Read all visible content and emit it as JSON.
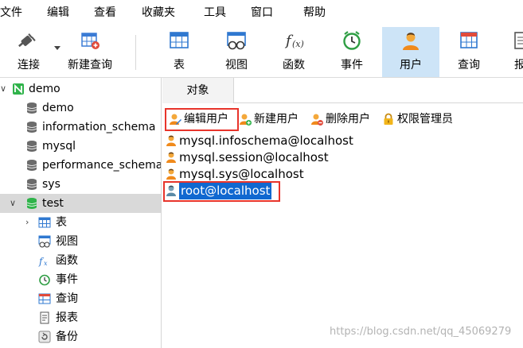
{
  "menu": [
    "文件",
    "编辑",
    "查看",
    "收藏夹",
    "工具",
    "窗口",
    "帮助"
  ],
  "toolbar": {
    "items": [
      {
        "label": "连接",
        "icon": "plug-icon"
      },
      {
        "label": "新建查询",
        "icon": "new-query-icon"
      },
      {
        "label": "表",
        "icon": "table-icon"
      },
      {
        "label": "视图",
        "icon": "view-icon"
      },
      {
        "label": "函数",
        "icon": "function-icon"
      },
      {
        "label": "事件",
        "icon": "clock-icon"
      },
      {
        "label": "用户",
        "icon": "user-icon"
      },
      {
        "label": "查询",
        "icon": "query-icon"
      },
      {
        "label": "报",
        "icon": "report-icon"
      }
    ],
    "active": "用户"
  },
  "tree": {
    "connection": "demo",
    "databases": [
      "demo",
      "information_schema",
      "mysql",
      "performance_schema",
      "sys",
      "test"
    ],
    "open_database": "test",
    "children": [
      {
        "label": "表",
        "icon": "table-icon"
      },
      {
        "label": "视图",
        "icon": "view-icon"
      },
      {
        "label": "函数",
        "icon": "function-icon"
      },
      {
        "label": "事件",
        "icon": "clock-icon"
      },
      {
        "label": "查询",
        "icon": "query-icon"
      },
      {
        "label": "报表",
        "icon": "report-icon"
      },
      {
        "label": "备份",
        "icon": "backup-icon"
      }
    ]
  },
  "tab": {
    "label": "对象"
  },
  "object_toolbar": {
    "edit_user": "编辑用户",
    "new_user": "新建用户",
    "delete_user": "删除用户",
    "privilege_manager": "权限管理员"
  },
  "users": [
    "mysql.infoschema@localhost",
    "mysql.session@localhost",
    "mysql.sys@localhost",
    "root@localhost"
  ],
  "selected_user": "root@localhost",
  "watermark": "https://blog.csdn.net/qq_45069279",
  "colors": {
    "selection": "#1068d0",
    "active_tool": "#cde4f7",
    "highlight_box": "#e8342b",
    "db_icon": "#6b6b6b",
    "db_open_icon": "#2fb34a"
  }
}
